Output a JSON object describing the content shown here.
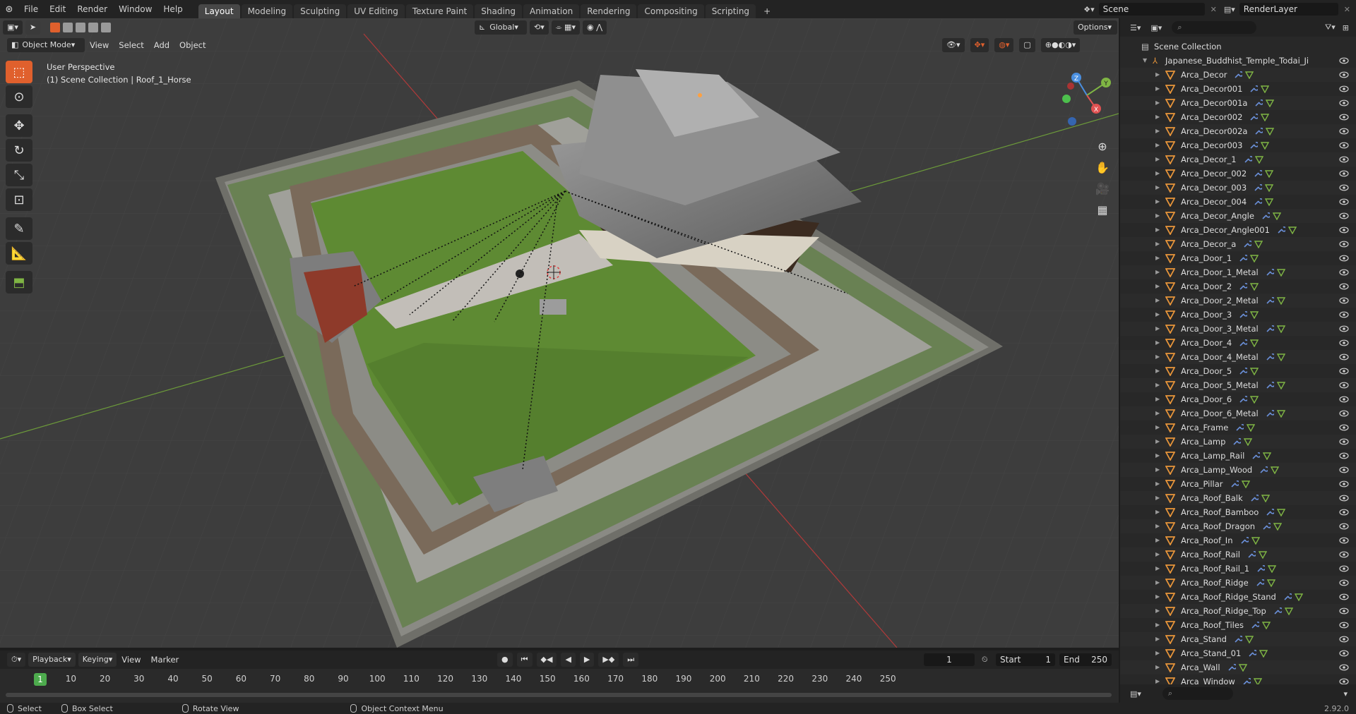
{
  "topbar": {
    "menu": [
      "File",
      "Edit",
      "Render",
      "Window",
      "Help"
    ],
    "workspaces": [
      "Layout",
      "Modeling",
      "Sculpting",
      "UV Editing",
      "Texture Paint",
      "Shading",
      "Animation",
      "Rendering",
      "Compositing",
      "Scripting"
    ],
    "active_workspace": "Layout",
    "scene": "Scene",
    "render_layer": "RenderLayer"
  },
  "viewport": {
    "mode": "Object Mode",
    "menu": [
      "View",
      "Select",
      "Add",
      "Object"
    ],
    "orientation": "Global",
    "options_label": "Options",
    "info_line1": "User Perspective",
    "info_line2": "(1) Scene Collection | Roof_1_Horse",
    "gizmo": {
      "x": "X",
      "y": "Y",
      "z": "Z"
    }
  },
  "outliner": {
    "root": "Scene Collection",
    "collection": "Japanese_Buddhist_Temple_Todai_Ji",
    "items": [
      "Arca_Decor",
      "Arca_Decor001",
      "Arca_Decor001a",
      "Arca_Decor002",
      "Arca_Decor002a",
      "Arca_Decor003",
      "Arca_Decor_1",
      "Arca_Decor_002",
      "Arca_Decor_003",
      "Arca_Decor_004",
      "Arca_Decor_Angle",
      "Arca_Decor_Angle001",
      "Arca_Decor_a",
      "Arca_Door_1",
      "Arca_Door_1_Metal",
      "Arca_Door_2",
      "Arca_Door_2_Metal",
      "Arca_Door_3",
      "Arca_Door_3_Metal",
      "Arca_Door_4",
      "Arca_Door_4_Metal",
      "Arca_Door_5",
      "Arca_Door_5_Metal",
      "Arca_Door_6",
      "Arca_Door_6_Metal",
      "Arca_Frame",
      "Arca_Lamp",
      "Arca_Lamp_Rail",
      "Arca_Lamp_Wood",
      "Arca_Pillar",
      "Arca_Roof_Balk",
      "Arca_Roof_Bamboo",
      "Arca_Roof_Dragon",
      "Arca_Roof_In",
      "Arca_Roof_Rail",
      "Arca_Roof_Rail_1",
      "Arca_Roof_Ridge",
      "Arca_Roof_Ridge_Stand",
      "Arca_Roof_Ridge_Top",
      "Arca_Roof_Tiles",
      "Arca_Stand",
      "Arca_Stand_01",
      "Arca_Wall",
      "Arca_Window"
    ]
  },
  "timeline": {
    "menu": [
      "Playback",
      "Keying",
      "View",
      "Marker"
    ],
    "current_frame": "1",
    "start_label": "Start",
    "start": "1",
    "end_label": "End",
    "end": "250",
    "ticks": [
      "10",
      "20",
      "30",
      "40",
      "50",
      "60",
      "70",
      "80",
      "90",
      "100",
      "110",
      "120",
      "130",
      "140",
      "150",
      "160",
      "170",
      "180",
      "190",
      "200",
      "210",
      "220",
      "230",
      "240",
      "250"
    ]
  },
  "statusbar": {
    "select": "Select",
    "box_select": "Box Select",
    "rotate_view": "Rotate View",
    "context_menu": "Object Context Menu",
    "version": "2.92.0"
  },
  "colors": {
    "accent": "#e0602d",
    "frame_current": "#4dab4d",
    "object_icon": "#e8953a",
    "x_axis": "#e05252",
    "y_axis": "#7fb544",
    "z_axis": "#4a8fe0"
  }
}
